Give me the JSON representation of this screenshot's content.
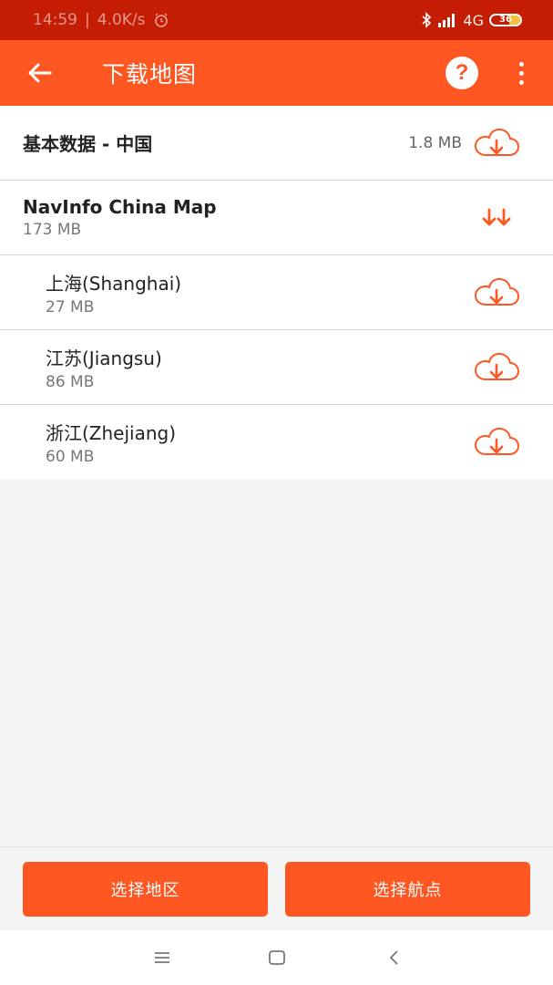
{
  "status_bar": {
    "time": "14:59",
    "separator": "|",
    "speed": "4.0K/s",
    "network": "4G",
    "battery": "36"
  },
  "app_bar": {
    "title": "下载地图",
    "help_label": "?"
  },
  "list": {
    "basic": {
      "title": "基本数据 - 中国",
      "size": "1.8 MB"
    },
    "group": {
      "title": "NavInfo China Map",
      "size": "173 MB"
    },
    "regions": [
      {
        "title": "上海(Shanghai)",
        "size": "27 MB"
      },
      {
        "title": "江苏(Jiangsu)",
        "size": "86 MB"
      },
      {
        "title": "浙江(Zhejiang)",
        "size": "60 MB"
      }
    ]
  },
  "buttons": {
    "select_region": "选择地区",
    "select_waypoint": "选择航点"
  },
  "colors": {
    "accent": "#ff5722",
    "status_bar": "#c41d03"
  }
}
